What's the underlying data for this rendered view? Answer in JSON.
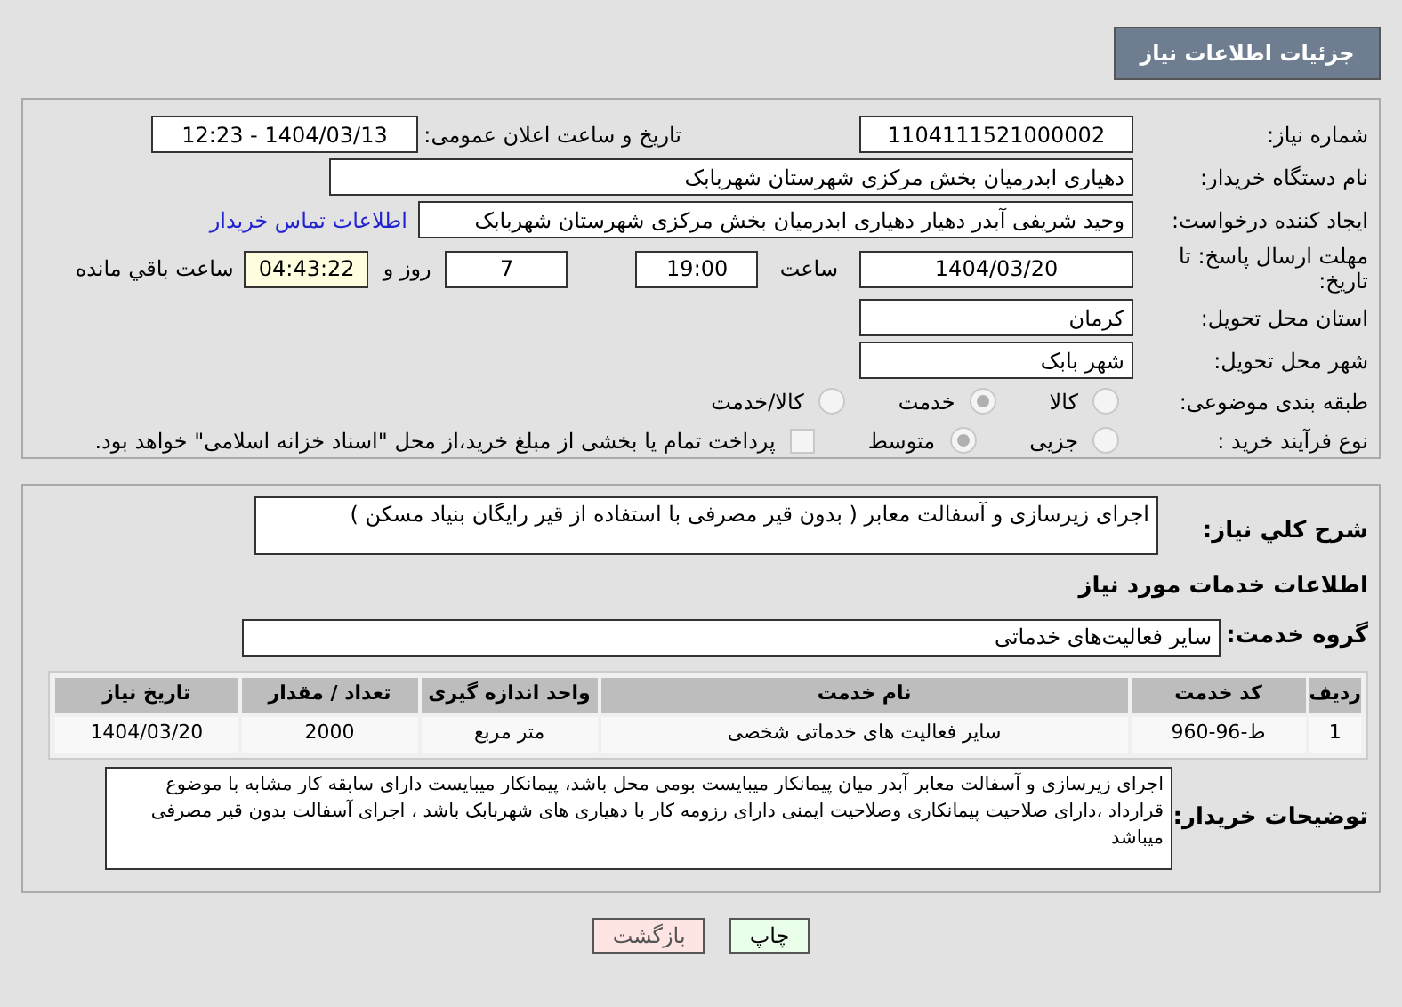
{
  "header": {
    "title": "جزئیات اطلاعات نیاز"
  },
  "need_number": {
    "label": "شماره نیاز:",
    "value": "1104111521000002"
  },
  "announce": {
    "label": "تاریخ و ساعت اعلان عمومی:",
    "value": "1404/03/13 - 12:23"
  },
  "buyer": {
    "label": "نام دستگاه خریدار:",
    "value": "دهیاری ابدرمیان بخش مرکزی شهرستان شهربابک"
  },
  "creator": {
    "label": "ایجاد کننده درخواست:",
    "value": "وحید شریفی آبدر دهیار دهیاری ابدرمیان بخش مرکزی شهرستان شهربابک",
    "link": "اطلاعات تماس خریدار"
  },
  "deadline": {
    "label": "مهلت ارسال پاسخ: تا تاریخ:",
    "date": "1404/03/20",
    "time_label": "ساعت",
    "time": "19:00",
    "days": "7",
    "days_label": "روز و",
    "remaining": "04:43:22",
    "remaining_label": "ساعت باقي مانده"
  },
  "province": {
    "label": "استان محل تحویل:",
    "value": "کرمان"
  },
  "city": {
    "label": "شهر محل تحویل:",
    "value": "شهر بابک"
  },
  "category": {
    "label": "طبقه بندی موضوعی:",
    "options": [
      {
        "label": "کالا",
        "selected": false
      },
      {
        "label": "خدمت",
        "selected": true
      },
      {
        "label": "کالا/خدمت",
        "selected": false
      }
    ]
  },
  "process": {
    "label": "نوع فرآیند خرید :",
    "options": [
      {
        "label": "جزیی",
        "selected": false
      },
      {
        "label": "متوسط",
        "selected": true
      }
    ],
    "treasury": {
      "label": "پرداخت تمام یا بخشی از مبلغ خرید،از محل \"اسناد خزانه اسلامی\" خواهد بود.",
      "checked": false
    }
  },
  "summary": {
    "label": "شرح کلي نياز:",
    "value": "اجرای زیرسازی و آسفالت معابر (  بدون قیر مصرفی با استفاده از قیر رایگان بنیاد مسکن )"
  },
  "services_heading": "اطلاعات خدمات مورد نیاز",
  "service_group": {
    "label": "گروه خدمت:",
    "value": "سایر فعالیت‌های خدماتی"
  },
  "table": {
    "columns": [
      "ردیف",
      "کد خدمت",
      "نام خدمت",
      "واحد اندازه گیری",
      "تعداد / مقدار",
      "تاریخ نیاز"
    ],
    "rows": [
      [
        "1",
        "ط-96-960",
        "سایر فعالیت های خدماتی شخصی",
        "متر مربع",
        "2000",
        "1404/03/20"
      ]
    ]
  },
  "buyer_notes": {
    "label": "توضیحات خریدار:",
    "value": "اجرای زیرسازی و آسفالت معابر آبدر میان پیمانکار میبایست بومی محل باشد، پیمانکار میبایست دارای سابقه کار مشابه با موضوع قرارداد ،دارای صلاحیت پیمانکاری وصلاحیت ایمنی  دارای رزومه کار با دهیاری های  شهربابک باشد ، اجرای آسفالت بدون قیر مصرفی میباشد"
  },
  "buttons": [
    {
      "label": "چاپ",
      "kind": "print"
    },
    {
      "label": "بازگشت",
      "kind": "back"
    }
  ]
}
